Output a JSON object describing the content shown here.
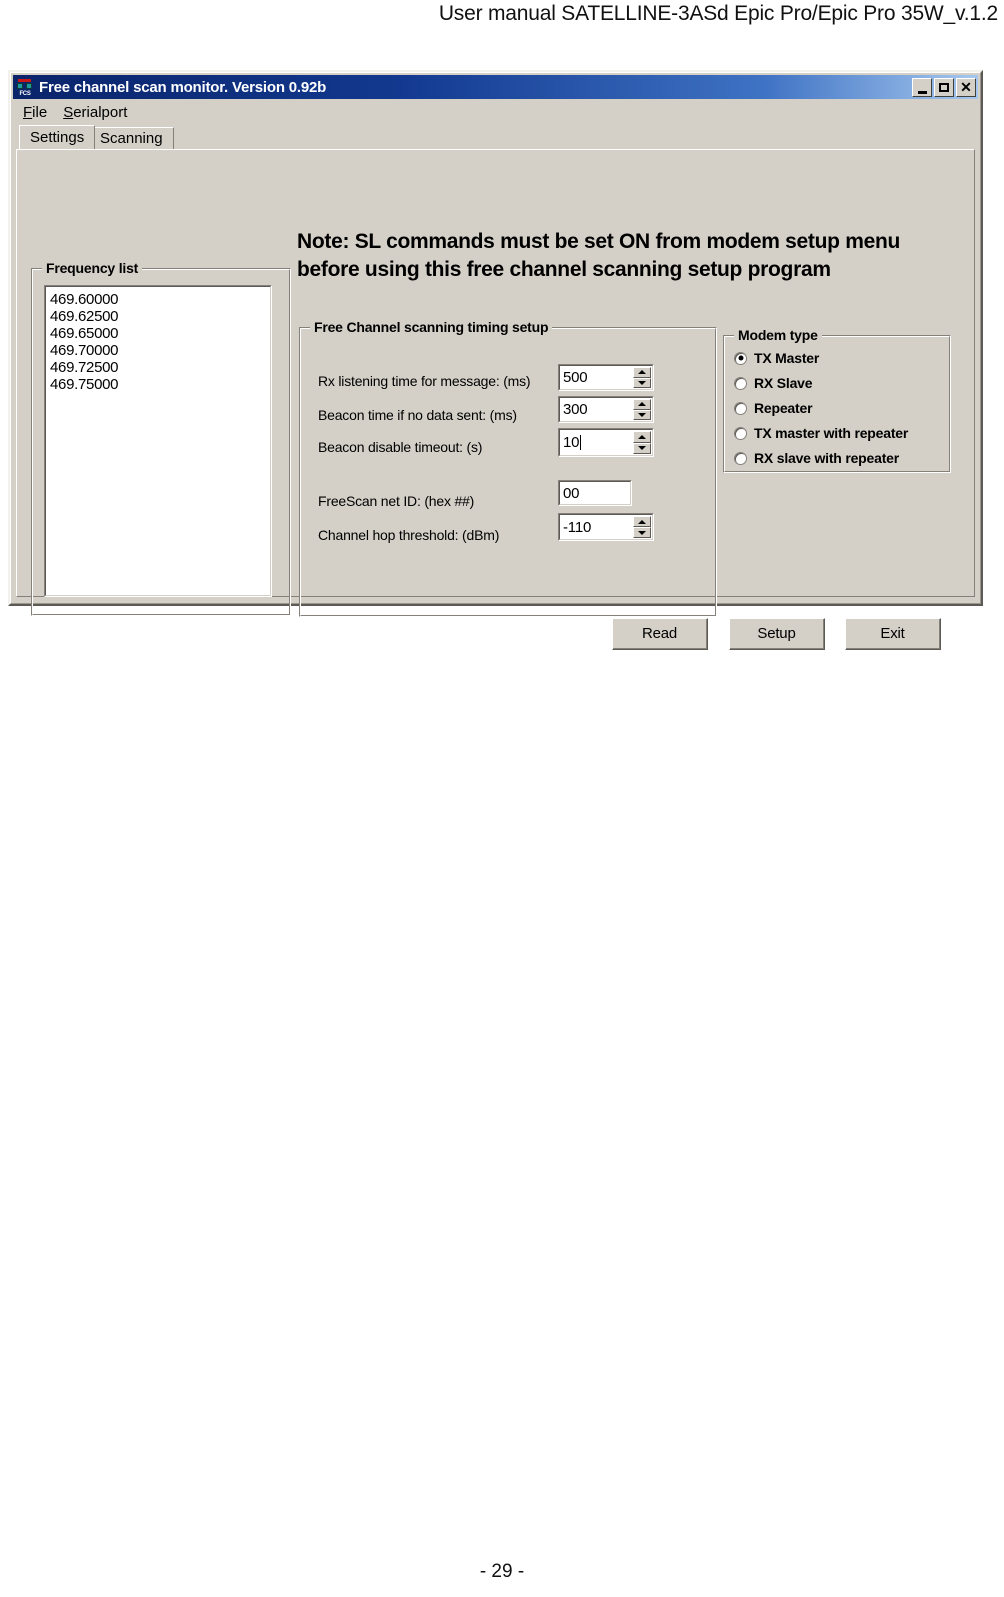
{
  "page": {
    "header": "User manual SATELLINE-3ASd Epic Pro/Epic Pro 35W_v.1.2",
    "footer": "- 29 -"
  },
  "window": {
    "title": "Free channel scan monitor. Version 0.92b",
    "icon": "fcs-app-icon",
    "controls": {
      "minimize": "_",
      "maximize": "□",
      "close": "✕"
    }
  },
  "menubar": {
    "items": [
      {
        "label": "File",
        "mnemonic": "F",
        "rest": "ile"
      },
      {
        "label": "Serialport",
        "mnemonic": "S",
        "rest": "erialport"
      }
    ]
  },
  "tabs": [
    {
      "label": "Settings",
      "active": true
    },
    {
      "label": "Scanning",
      "active": false
    }
  ],
  "note": {
    "line1": "Note: SL commands must be set ON from modem setup menu",
    "line2": "before using this free channel scanning setup program"
  },
  "frequency_list": {
    "title": "Frequency list",
    "items": [
      "469.60000",
      "469.62500",
      "469.65000",
      "469.70000",
      "469.72500",
      "469.75000"
    ]
  },
  "timing_setup": {
    "title": "Free Channel scanning timing setup",
    "fields": [
      {
        "label": "Rx listening time for message: (ms)",
        "value": "500",
        "spinner": true,
        "focused": false
      },
      {
        "label": "Beacon time if no data sent: (ms)",
        "value": "300",
        "spinner": true,
        "focused": false
      },
      {
        "label": "Beacon disable timeout: (s)",
        "value": "10",
        "spinner": true,
        "focused": true
      },
      {
        "label": "FreeScan net ID: (hex ##)",
        "value": "00",
        "spinner": false,
        "focused": false
      },
      {
        "label": "Channel hop threshold: (dBm)",
        "value": "-110",
        "spinner": true,
        "focused": false
      }
    ]
  },
  "modem_type": {
    "title": "Modem type",
    "options": [
      {
        "label": "TX Master",
        "selected": true
      },
      {
        "label": "RX Slave",
        "selected": false
      },
      {
        "label": "Repeater",
        "selected": false
      },
      {
        "label": "TX master with repeater",
        "selected": false
      },
      {
        "label": "RX slave with repeater",
        "selected": false
      }
    ]
  },
  "buttons": {
    "read": "Read",
    "setup": "Setup",
    "exit": "Exit"
  },
  "colors": {
    "dialog_face": "#d4d0c8",
    "titlebar_start": "#0a246a",
    "titlebar_end": "#a6c8ef",
    "field_bg": "#ffffff",
    "text": "#000000"
  }
}
